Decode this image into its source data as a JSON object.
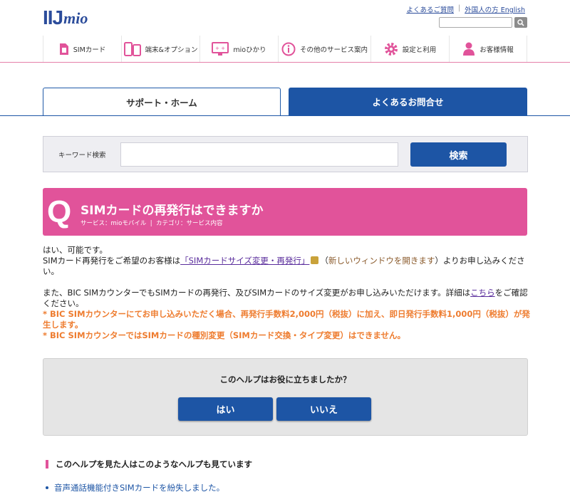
{
  "header": {
    "logo_text_main": "IIJ",
    "logo_text_sub": "mio",
    "links": [
      "よくあるご質問",
      "外国人の方 English"
    ],
    "search_placeholder": ""
  },
  "nav": [
    {
      "label": "SIMカード",
      "icon": "sim-card-icon"
    },
    {
      "label": "端末&オプション",
      "icon": "devices-icon"
    },
    {
      "label": "mioひかり",
      "icon": "monitor-icon"
    },
    {
      "label": "その他のサービス案内",
      "icon": "info-icon"
    },
    {
      "label": "設定と利用",
      "icon": "gear-icon"
    },
    {
      "label": "お客様情報",
      "icon": "user-icon"
    }
  ],
  "tabs": {
    "support": "サポート・ホーム",
    "faq": "よくあるお問合せ"
  },
  "keyword_search": {
    "label": "キーワード検索",
    "value": "",
    "button": "検索"
  },
  "question": {
    "letter": "Q",
    "title": "SIMカードの再発行はできますか",
    "service_label": "サービス：mioモバイル",
    "separator": "|",
    "category_label": "カテゴリ：サービス内容"
  },
  "answer": {
    "line1": "はい、可能です。",
    "line2_pre": "SIMカード再発行をご希望のお客様は",
    "line2_link": "「SIMカードサイズ変更・再発行」",
    "line2_paren_open": "（",
    "line2_newwin": "新しいウィンドウを開きます",
    "line2_paren_close": "）",
    "line2_post": "よりお申し込みください。",
    "line3_pre": "また、BIC SIMカウンターでもSIMカードの再発行、及びSIMカードのサイズ変更がお申し込みいただけます。詳細は",
    "line3_link": "こちら",
    "line3_post": "をご確認ください。",
    "warn1": "* BIC SIMカウンターにてお申し込みいただく場合、再発行手数料2,000円（税抜）に加え、即日発行手数料1,000円（税抜）が発生します。",
    "warn2": "* BIC SIMカウンターではSIMカードの種別変更（SIMカード交換・タイプ変更）はできません。"
  },
  "feedback": {
    "question": "このヘルプはお役に立ちましたか？",
    "yes": "はい",
    "no": "いいえ"
  },
  "related": {
    "title": "このヘルプを見た人はこのようなヘルプも見ています",
    "items": [
      "音声通話機能付きSIMカードを紛失しました。"
    ]
  },
  "colors": {
    "brand_blue": "#1d55a5",
    "pink": "#e1539a",
    "warning_orange": "#ee7c2f"
  }
}
